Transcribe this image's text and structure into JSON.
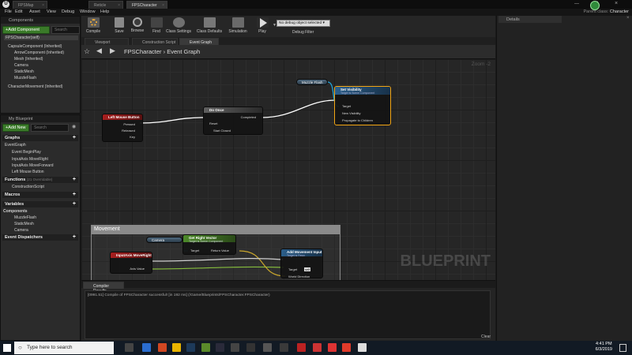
{
  "titlebar": {
    "tabs": [
      "FPSMap",
      "Reticle",
      "FPSCharacter"
    ]
  },
  "menubar": {
    "items": [
      "File",
      "Edit",
      "Asset",
      "View",
      "Debug",
      "Window",
      "Help"
    ],
    "parent_class_label": "Parent class:",
    "parent_class_value": "Character"
  },
  "components": {
    "title": "Components",
    "add_button": "+Add Component",
    "search_placeholder": "Search",
    "root": "FPSCharacter(self)",
    "items": [
      "CapsuleComponent (Inherited)",
      "ArrowComponent (Inherited)",
      "Mesh (Inherited)",
      "Camera",
      "StaticMesh",
      "MuzzleFlash",
      "CharacterMovement (Inherited)"
    ]
  },
  "my_blueprint": {
    "title": "My Blueprint",
    "add_button": "+Add New",
    "search_placeholder": "Search",
    "graphs_label": "Graphs",
    "event_graph": "EventGraph",
    "events": [
      "Event BeginPlay",
      "InputAxis MoveRight",
      "InputAxis MoveForward",
      "Left Mouse Button"
    ],
    "functions_label": "Functions",
    "functions_note": "(21 Overridable)",
    "construction": "ConstructionScript",
    "macros_label": "Macros",
    "variables_label": "Variables",
    "comp_label": "Components",
    "comp_vars": [
      "MuzzleFlash",
      "StaticMesh",
      "Camera"
    ],
    "dispatchers_label": "Event Dispatchers"
  },
  "toolbar": {
    "buttons": [
      "Compile",
      "Save",
      "Browse",
      "Find",
      "Class Settings",
      "Class Defaults",
      "Simulation",
      "Play"
    ],
    "debug_select": "No debug object selected",
    "debug_label": "Debug Filter"
  },
  "doc_tabs": [
    "Viewport",
    "Construction Script",
    "Event Graph"
  ],
  "graph": {
    "breadcrumb_root": "FPSCharacter",
    "breadcrumb_sep": "›",
    "breadcrumb_leaf": "Event Graph",
    "zoom": "Zoom -2",
    "watermark": "BLUEPRINT",
    "nodes": {
      "lmb": {
        "title": "Left Mouse Button",
        "pins": [
          "Pressed",
          "Released",
          "Key"
        ]
      },
      "doonce": {
        "title": "Do Once",
        "pins": [
          "Reset",
          "Start Closed",
          "Completed"
        ]
      },
      "muzzle": {
        "title": "Muzzle Flash"
      },
      "setvis": {
        "title": "Set Visibility",
        "subtitle": "Target is Scene Component",
        "pins": [
          "Target",
          "New Visibility",
          "Propagate to Children"
        ]
      },
      "comment": {
        "title": "Movement"
      },
      "camera": {
        "title": "Camera"
      },
      "getright": {
        "title": "Get Right Vector",
        "subtitle": "Target is Scene Component",
        "pins": [
          "Target",
          "Return Value"
        ]
      },
      "moveright": {
        "title": "InputAxis MoveRight",
        "pins": [
          "Axis Value"
        ]
      },
      "addmove": {
        "title": "Add Movement Input",
        "subtitle": "Target is Pawn",
        "pins": [
          "Target",
          "self",
          "World Direction"
        ]
      }
    }
  },
  "compiler": {
    "tab": "Compiler Results",
    "log": "[0991.51] Compile of FPSCharacter successful! [in 192 ms] (/Game/Blueprints/FPSCharacter.FPSCharacter)",
    "clear": "Clear"
  },
  "details": {
    "tab": "Details"
  },
  "taskbar": {
    "search": "Type here to search",
    "time": "4:41 PM",
    "date": "6/3/2019"
  },
  "colors": {
    "exec": "#ffffff",
    "object": "#1fa3d9",
    "vector": "#f5c623",
    "float": "#9be43a",
    "bool": "#a11f1f",
    "selected": "#f2a514"
  }
}
